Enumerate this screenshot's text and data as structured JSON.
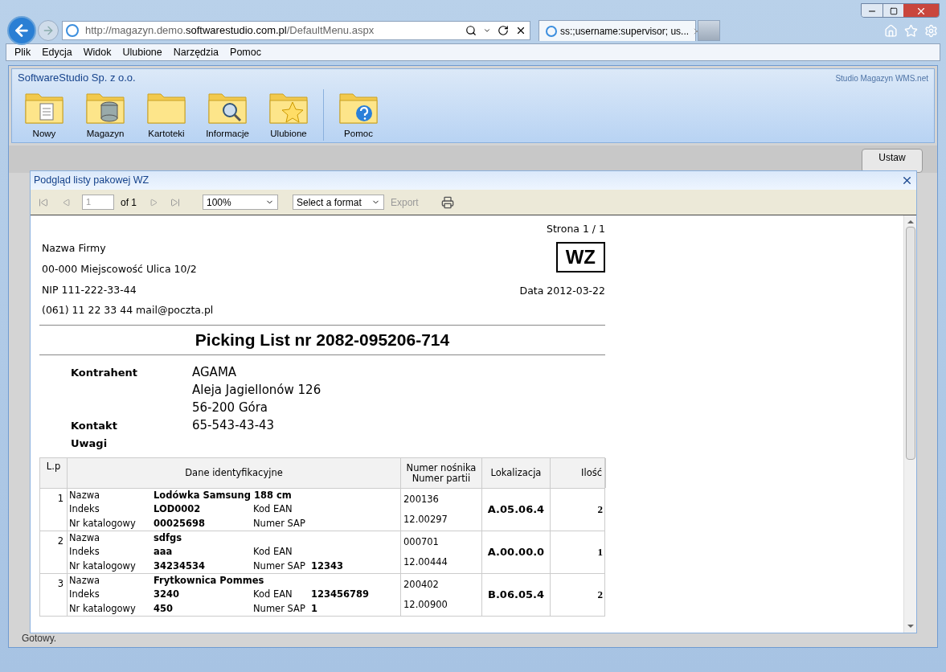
{
  "browser": {
    "address_host_pre": "http://magazyn.demo.",
    "address_host": "softwarestudio.com.pl",
    "address_path": "/DefaultMenu.aspx",
    "tab_title": "ss:;username:supervisor; us...",
    "menu": [
      "Plik",
      "Edycja",
      "Widok",
      "Ulubione",
      "Narzędzia",
      "Pomoc"
    ]
  },
  "app": {
    "company": "SoftwareStudio Sp. z o.o.",
    "product": "Studio Magazyn WMS.net",
    "ribbon": [
      {
        "label": "Nowy",
        "kind": "document"
      },
      {
        "label": "Magazyn",
        "kind": "database"
      },
      {
        "label": "Kartoteki",
        "kind": "folder"
      },
      {
        "label": "Informacje",
        "kind": "search"
      },
      {
        "label": "Ulubione",
        "kind": "star"
      },
      {
        "label": "Pomoc",
        "kind": "help"
      }
    ],
    "set_button": "Ustaw",
    "status": "Gotowy."
  },
  "modal": {
    "title": "Podgląd listy pakowej WZ",
    "toolbar": {
      "page": "1",
      "of": "of 1",
      "zoom": "100%",
      "format": "Select a format",
      "export": "Export",
      "export_disabled": true
    },
    "report": {
      "page": "Strona 1 / 1",
      "doc_type": "WZ",
      "date": "Data 2012-03-22",
      "company_lines": [
        "Nazwa Firmy",
        "00-000 Miejscowość Ulica 10/2",
        "NIP 111-222-33-44",
        "(061) 11 22 33 44 mail@poczta.pl"
      ],
      "title": "Picking List nr 2082-095206-714",
      "contractor": [
        {
          "label": "Kontrahent",
          "lines": [
            "AGAMA",
            "Aleja Jagiellonów 126",
            "56-200 Góra"
          ]
        },
        {
          "label": "Kontakt",
          "lines": [
            "65-543-43-43"
          ]
        },
        {
          "label": "Uwagi"
        }
      ],
      "columns": [
        "L.p",
        "Dane identyfikacyjne",
        "Numer nośnika\nNumer partii",
        "Lokalizacja",
        "Ilość"
      ],
      "rows": [
        {
          "lp": "1",
          "name_label": "Nazwa",
          "name": "Lodówka Samsung 188 cm",
          "index_label": "Indeks",
          "index": "LOD0002",
          "ean_label": "Kod EAN",
          "catalog_label": "Nr katalogowy",
          "catalog": "00025698",
          "sap_label": "Numer SAP",
          "carrier": "200136",
          "batch": "12.00297",
          "location": "A.05.06.4",
          "qty": "2"
        },
        {
          "lp": "2",
          "name_label": "Nazwa",
          "name": "sdfgs",
          "index_label": "Indeks",
          "index": "aaa",
          "ean_label": "Kod EAN",
          "catalog_label": "Nr katalogowy",
          "catalog": "34234534",
          "sap_label": "Numer SAP",
          "sap": "12343",
          "carrier": "000701",
          "batch": "12.00444",
          "location": "A.00.00.0",
          "qty": "1"
        },
        {
          "lp": "3",
          "name_label": "Nazwa",
          "name": "Frytkownica Pommes",
          "index_label": "Indeks",
          "index": "3240",
          "ean_label": "Kod EAN",
          "ean": "123456789",
          "catalog_label": "Nr katalogowy",
          "catalog": "450",
          "sap_label": "Numer SAP",
          "sap": "1",
          "carrier": "200402",
          "batch": "12.00900",
          "location": "B.06.05.4",
          "qty": "2"
        }
      ]
    }
  }
}
